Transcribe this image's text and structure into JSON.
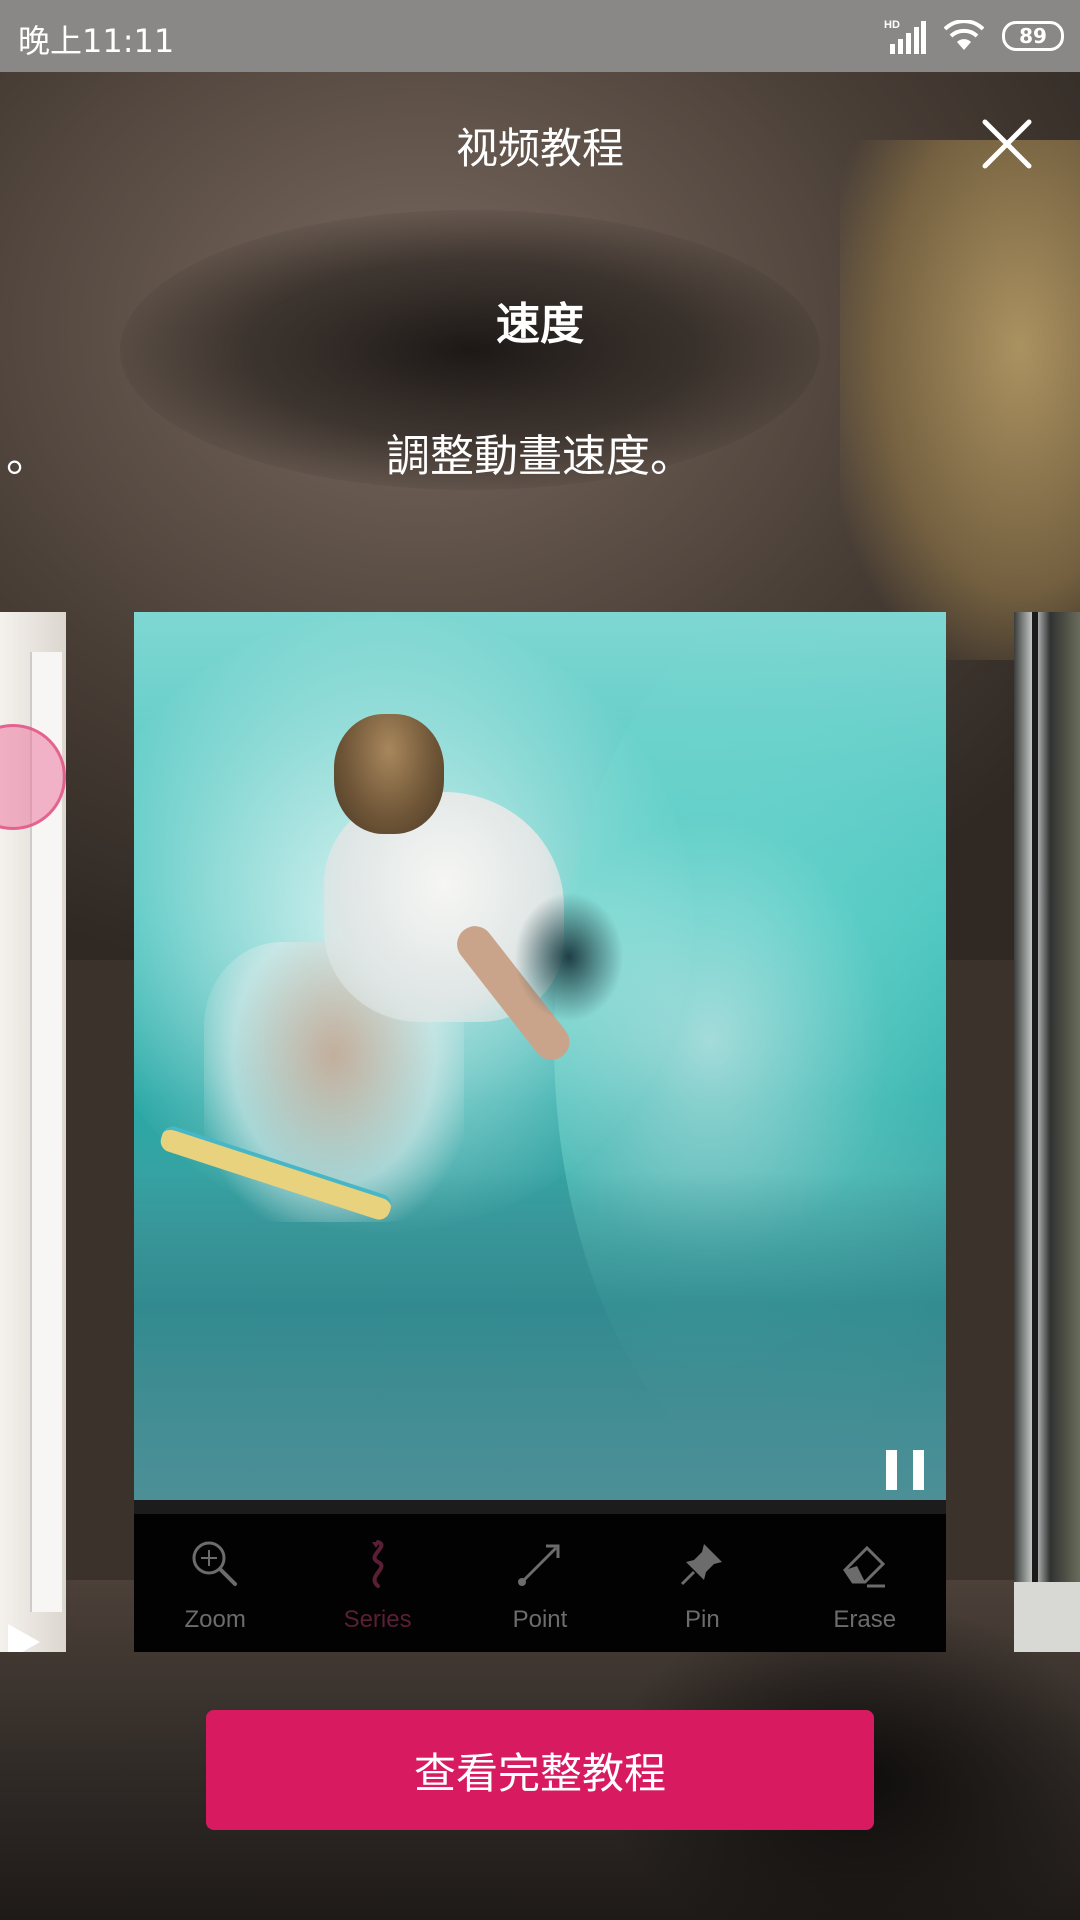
{
  "status_bar": {
    "time": "晚上11:11",
    "network_label": "HD",
    "battery": "89"
  },
  "header": {
    "title": "视频教程"
  },
  "slide": {
    "heading": "速度",
    "description": "調整動畫速度。",
    "prev_description_tail": "。"
  },
  "toolbar": {
    "items": [
      {
        "label": "Zoom",
        "icon": "zoom-icon",
        "active": false
      },
      {
        "label": "Series",
        "icon": "series-icon",
        "active": true
      },
      {
        "label": "Point",
        "icon": "point-icon",
        "active": false
      },
      {
        "label": "Pin",
        "icon": "pin-icon",
        "active": false
      },
      {
        "label": "Erase",
        "icon": "erase-icon",
        "active": false
      }
    ]
  },
  "cta": {
    "label": "查看完整教程"
  },
  "colors": {
    "accent": "#d81b60",
    "status_bar": "#8a8886"
  }
}
